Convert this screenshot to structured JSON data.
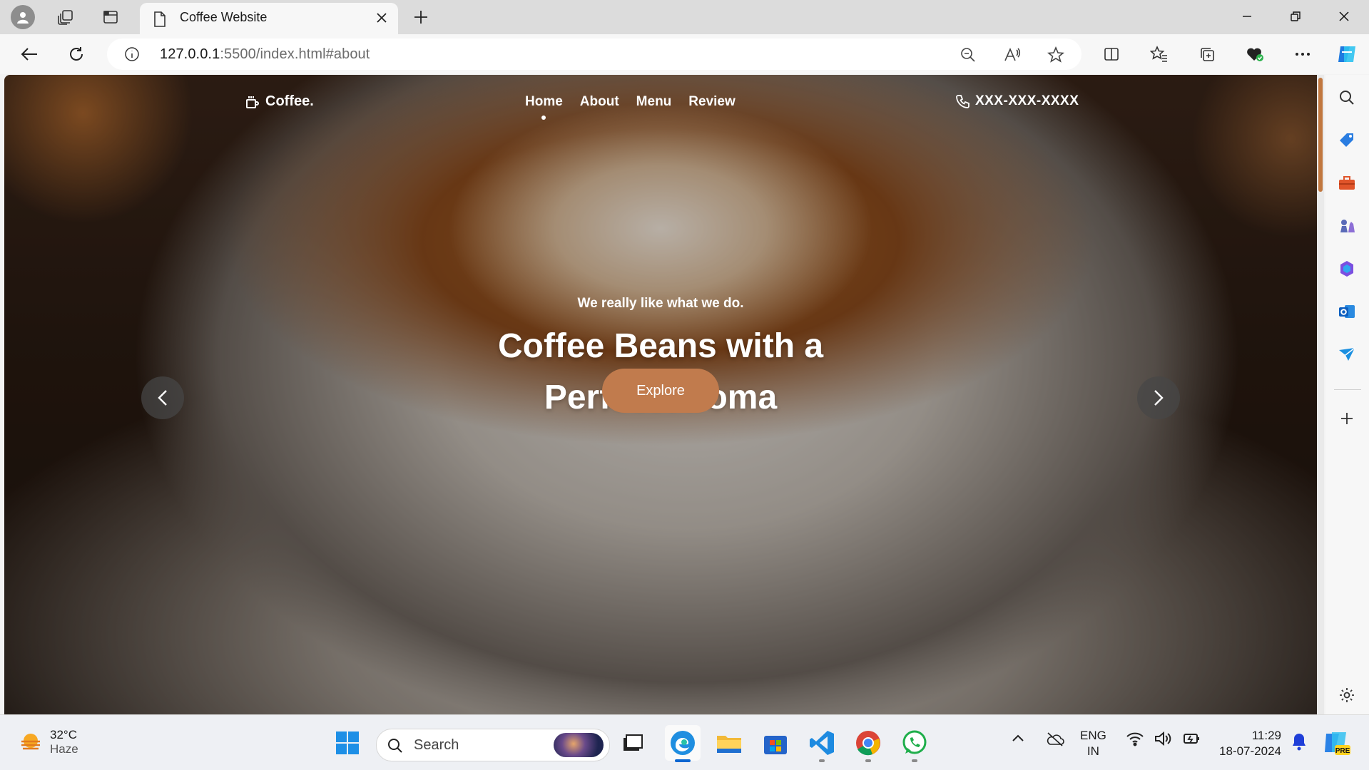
{
  "browser": {
    "tab_title": "Coffee Website",
    "url_host": "127.0.0.1",
    "url_path": ":5500/index.html#about"
  },
  "site": {
    "logo": "Coffee.",
    "nav": [
      "Home",
      "About",
      "Menu",
      "Review"
    ],
    "active_nav": "Home",
    "phone": "XXX-XXX-XXXX",
    "hero_subtitle": "We really like what we do.",
    "hero_title_line1": "Coffee Beans with a",
    "hero_title_line2": "Perfect Aroma",
    "cta": "Explore",
    "accent_color": "#c17b4d"
  },
  "taskbar": {
    "temperature": "32°C",
    "condition": "Haze",
    "search_placeholder": "Search",
    "lang_line1": "ENG",
    "lang_line2": "IN",
    "time": "11:29",
    "date": "18-07-2024"
  }
}
